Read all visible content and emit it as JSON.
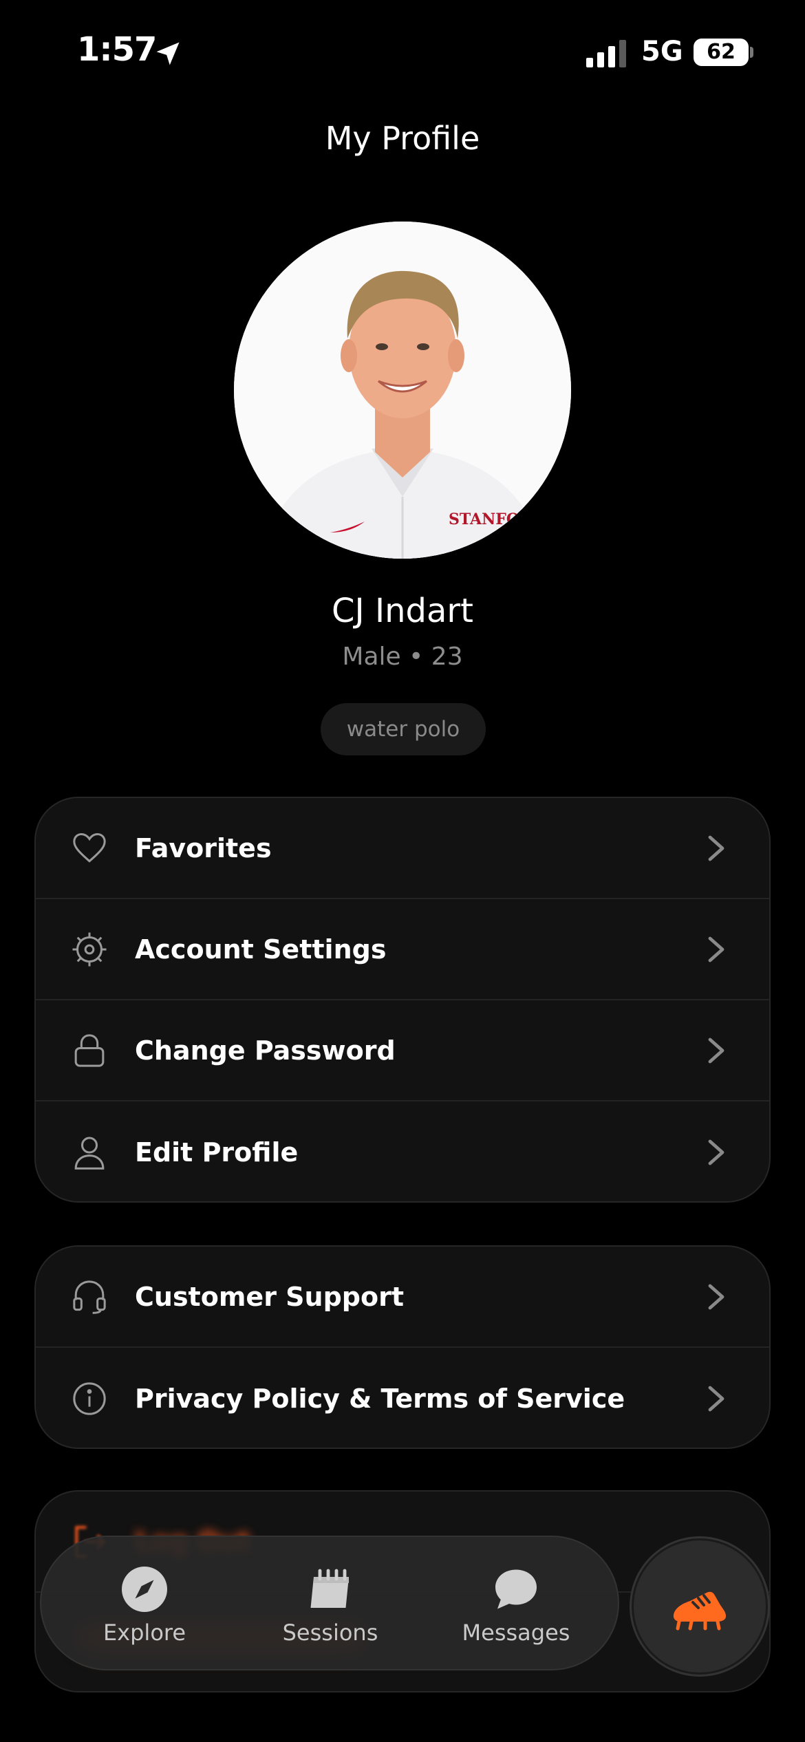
{
  "status_bar": {
    "time": "1:57",
    "network": "5G",
    "battery": "62"
  },
  "header": {
    "title": "My Profile"
  },
  "profile": {
    "name": "CJ Indart",
    "meta": "Male • 23",
    "tag": "water polo",
    "shirt_text": "STANFORD"
  },
  "menu_primary": [
    {
      "label": "Favorites",
      "icon": "heart-icon"
    },
    {
      "label": "Account Settings",
      "icon": "gear-icon"
    },
    {
      "label": "Change Password",
      "icon": "lock-icon"
    },
    {
      "label": "Edit Profile",
      "icon": "user-icon"
    }
  ],
  "menu_secondary": [
    {
      "label": "Customer Support",
      "icon": "headset-icon"
    },
    {
      "label": "Privacy Policy & Terms of Service",
      "icon": "info-icon"
    }
  ],
  "logout": {
    "label": "Log Out",
    "icon": "logout-icon"
  },
  "tabbar": {
    "tabs": [
      {
        "label": "Explore",
        "icon": "compass-icon"
      },
      {
        "label": "Sessions",
        "icon": "calendar-icon"
      },
      {
        "label": "Messages",
        "icon": "chat-bubble-icon"
      }
    ],
    "fab_icon": "cleat-icon"
  },
  "colors": {
    "background": "#000000",
    "card": "#121212",
    "accent": "#ff5a1f",
    "muted_text": "#8d8d8d"
  }
}
